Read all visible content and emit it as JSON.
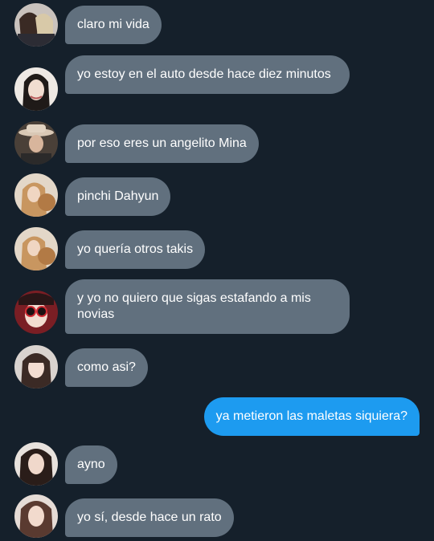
{
  "conversation": {
    "messages": [
      {
        "sender": "incoming",
        "text": "claro mi vida"
      },
      {
        "sender": "incoming",
        "text": "yo estoy en el auto desde hace diez minutos"
      },
      {
        "sender": "incoming",
        "text": "por eso eres un angelito Mina"
      },
      {
        "sender": "incoming",
        "text": "pinchi Dahyun"
      },
      {
        "sender": "incoming",
        "text": "yo quería otros takis"
      },
      {
        "sender": "incoming",
        "text": "y yo no quiero que sigas estafando a mis novias"
      },
      {
        "sender": "incoming",
        "text": "como asi?"
      },
      {
        "sender": "outgoing",
        "text": "ya metieron las maletas siquiera?"
      },
      {
        "sender": "incoming",
        "text": "ayno"
      },
      {
        "sender": "incoming",
        "text": "yo sí, desde hace un rato"
      }
    ]
  },
  "colors": {
    "background": "#15202b",
    "incoming_bubble": "#61707e",
    "outgoing_bubble": "#1d9bf0",
    "text": "#ffffff"
  }
}
